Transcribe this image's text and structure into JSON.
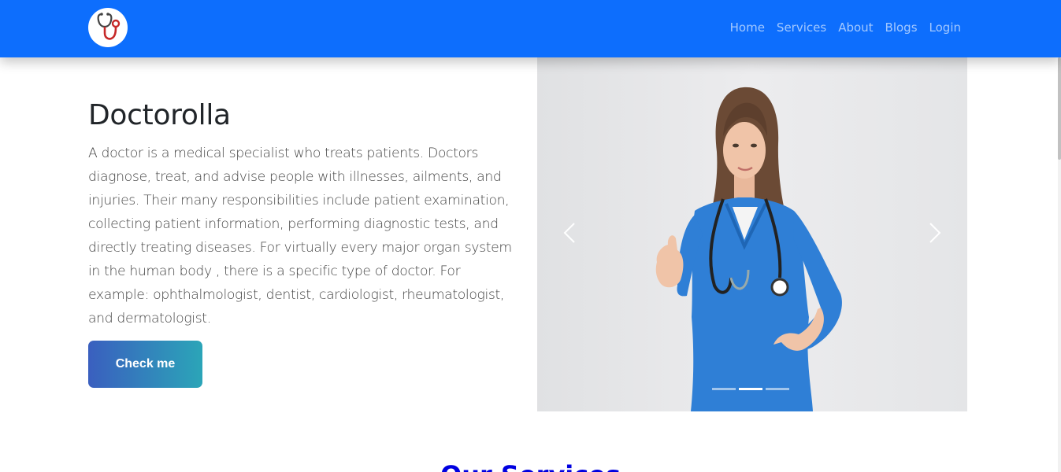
{
  "brand": {
    "logo_icon": "stethoscope-icon",
    "accent_color": "#0d6efd"
  },
  "nav": {
    "links": [
      "Home",
      "Services",
      "About",
      "Blogs",
      "Login"
    ]
  },
  "hero": {
    "title": "Doctorolla",
    "description": "A doctor is a medical specialist who treats patients. Doctors diagnose, treat, and advise people with illnesses, ailments, and injuries. Their many responsibilities include patient examination, collecting patient information, performing diagnostic tests, and directly treating diseases. For virtually every major organ system in the human body , there is a specific type of doctor. For example: ophthalmologist, dentist, cardiologist, rheumatologist, and dermatologist.",
    "button_label": "Check me"
  },
  "carousel": {
    "slide_count": 3,
    "active_slide": 2,
    "prev_icon": "chevron-left-icon",
    "next_icon": "chevron-right-icon"
  },
  "next_section": {
    "title": "Our Services"
  }
}
